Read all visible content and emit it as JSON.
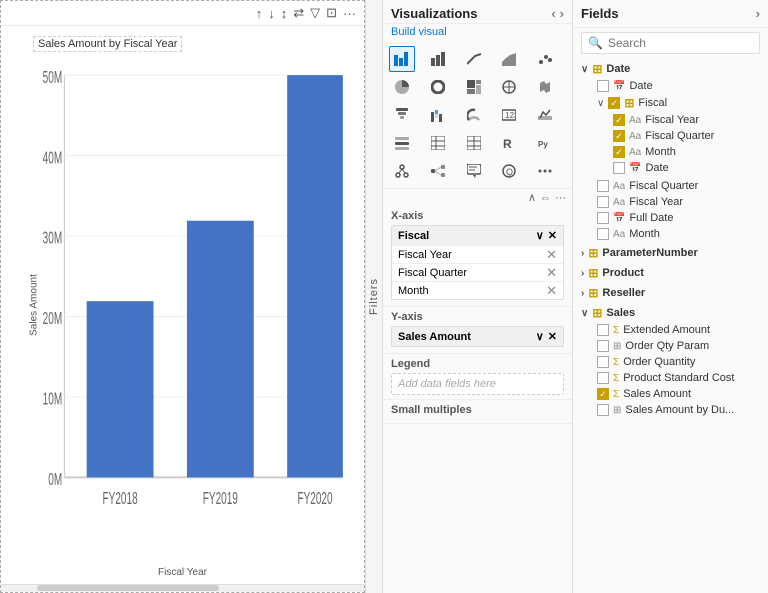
{
  "chart": {
    "title": "Sales Amount by Fiscal Year",
    "y_axis_label": "Sales Amount",
    "x_axis_label": "Fiscal Year",
    "bars": [
      {
        "label": "FY2018",
        "value": 22,
        "max": 55
      },
      {
        "label": "FY2019",
        "value": 32,
        "max": 55
      },
      {
        "label": "FY2020",
        "value": 50,
        "max": 55
      }
    ],
    "y_ticks": [
      "50M",
      "40M",
      "30M",
      "20M",
      "10M",
      "0M"
    ],
    "toolbar_icons": [
      "↑",
      "↓",
      "↕",
      "⇄",
      "▽",
      "⊡",
      "···"
    ]
  },
  "filters": {
    "label": "Filters"
  },
  "visualizations": {
    "title": "Visualizations",
    "build_visual": "Build visual",
    "icons": [
      {
        "name": "bar-chart-icon",
        "symbol": "▦",
        "active": true
      },
      {
        "name": "column-chart-icon",
        "symbol": "📊",
        "active": false
      },
      {
        "name": "line-chart-icon",
        "symbol": "📈",
        "active": false
      },
      {
        "name": "area-chart-icon",
        "symbol": "⛰",
        "active": false
      },
      {
        "name": "scatter-chart-icon",
        "symbol": "⁙",
        "active": false
      },
      {
        "name": "pie-chart-icon",
        "symbol": "◔",
        "active": false
      },
      {
        "name": "donut-chart-icon",
        "symbol": "◎",
        "active": false
      },
      {
        "name": "funnel-chart-icon",
        "symbol": "⑂",
        "active": false
      },
      {
        "name": "waterfall-icon",
        "symbol": "≋",
        "active": false
      },
      {
        "name": "ribbon-chart-icon",
        "symbol": "⌸",
        "active": false
      },
      {
        "name": "map-icon",
        "symbol": "🗺",
        "active": false
      },
      {
        "name": "filled-map-icon",
        "symbol": "⊞",
        "active": false
      },
      {
        "name": "treemap-icon",
        "symbol": "⊟",
        "active": false
      },
      {
        "name": "decomp-tree-icon",
        "symbol": "⊠",
        "active": false
      },
      {
        "name": "gauge-icon",
        "symbol": "◑",
        "active": false
      },
      {
        "name": "card-icon",
        "symbol": "▭",
        "active": false
      },
      {
        "name": "kpi-icon",
        "symbol": "⊻",
        "active": false
      },
      {
        "name": "slicer-icon",
        "symbol": "⊺",
        "active": false
      },
      {
        "name": "table-viz-icon",
        "symbol": "⊞",
        "active": false
      },
      {
        "name": "matrix-icon",
        "symbol": "⊟",
        "active": false
      },
      {
        "name": "r-visual-icon",
        "symbol": "R",
        "active": false
      },
      {
        "name": "python-icon",
        "symbol": "Py",
        "active": false
      },
      {
        "name": "key-influencers-icon",
        "symbol": "⊡",
        "active": false
      },
      {
        "name": "smart-narrative-icon",
        "symbol": "⊗",
        "active": false
      },
      {
        "name": "qa-icon",
        "symbol": "⊘",
        "active": false
      },
      {
        "name": "more-visuals-icon",
        "symbol": "···",
        "active": false
      }
    ],
    "xaxis": {
      "label": "X-axis",
      "field_group": "Fiscal",
      "items": [
        "Fiscal Year",
        "Fiscal Quarter",
        "Month"
      ]
    },
    "yaxis": {
      "label": "Y-axis",
      "item": "Sales Amount"
    },
    "legend": {
      "label": "Legend",
      "placeholder": "Add data fields here"
    },
    "small_multiples": {
      "label": "Small multiples"
    }
  },
  "fields": {
    "title": "Fields",
    "search_placeholder": "Search",
    "groups": [
      {
        "name": "Date",
        "icon": "table",
        "expanded": true,
        "children": [
          {
            "type": "field",
            "name": "Date",
            "checked": false,
            "field_type": "calendar"
          },
          {
            "type": "subgroup",
            "name": "Fiscal",
            "checked": true,
            "expanded": true,
            "children": [
              {
                "name": "Fiscal Year",
                "checked": true,
                "field_type": "text"
              },
              {
                "name": "Fiscal Quarter",
                "checked": true,
                "field_type": "text"
              },
              {
                "name": "Month",
                "checked": true,
                "field_type": "text"
              },
              {
                "name": "Date",
                "checked": false,
                "field_type": "calendar"
              }
            ]
          },
          {
            "type": "field",
            "name": "Fiscal Quarter",
            "checked": false,
            "field_type": "text"
          },
          {
            "type": "field",
            "name": "Fiscal Year",
            "checked": false,
            "field_type": "text"
          },
          {
            "type": "field",
            "name": "Full Date",
            "checked": false,
            "field_type": "calendar"
          },
          {
            "type": "field",
            "name": "Month",
            "checked": false,
            "field_type": "text"
          }
        ]
      },
      {
        "name": "ParameterNumber",
        "icon": "table",
        "expanded": false,
        "children": []
      },
      {
        "name": "Product",
        "icon": "table",
        "expanded": false,
        "children": []
      },
      {
        "name": "Reseller",
        "icon": "table",
        "expanded": false,
        "children": []
      },
      {
        "name": "Sales",
        "icon": "table",
        "expanded": true,
        "children": [
          {
            "type": "field",
            "name": "Extended Amount",
            "checked": false,
            "field_type": "sigma"
          },
          {
            "type": "field",
            "name": "Order Qty Param",
            "checked": false,
            "field_type": "table"
          },
          {
            "type": "field",
            "name": "Order Quantity",
            "checked": false,
            "field_type": "sigma"
          },
          {
            "type": "field",
            "name": "Product Standard Cost",
            "checked": false,
            "field_type": "sigma"
          },
          {
            "type": "field",
            "name": "Sales Amount",
            "checked": true,
            "field_type": "sigma"
          },
          {
            "type": "field",
            "name": "Sales Amount by Du...",
            "checked": false,
            "field_type": "table"
          }
        ]
      }
    ]
  }
}
